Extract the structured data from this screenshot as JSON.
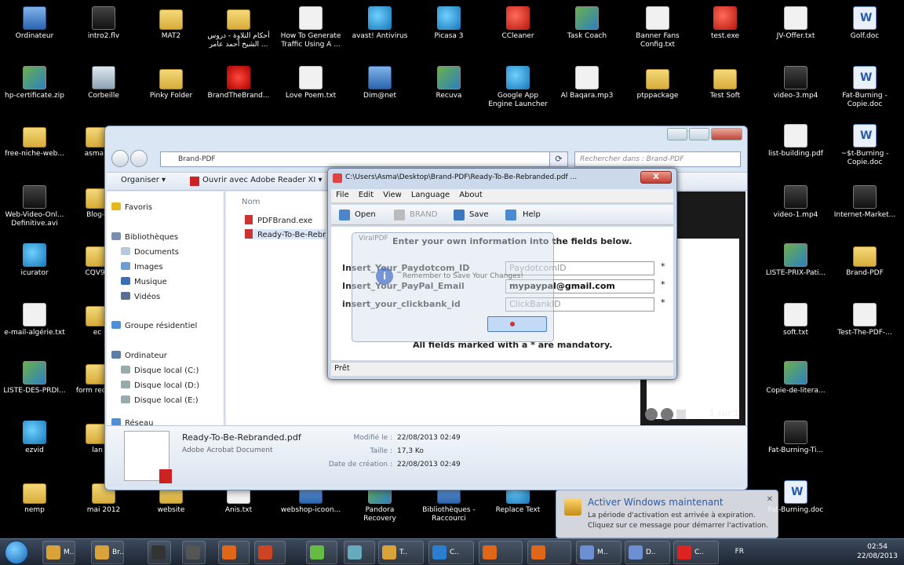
{
  "desktop": {
    "icons": [
      {
        "label": "Ordinateur",
        "icon": "computer-icon"
      },
      {
        "label": "intro2.flv",
        "icon": "video-file-icon"
      },
      {
        "label": "MAT2",
        "icon": "folder-icon"
      },
      {
        "label": "أحكام التلاوة - دروس الشيخ أحمد عامر ...",
        "icon": "folder-icon"
      },
      {
        "label": "How To Generate Traffic Using A ...",
        "icon": "text-file-icon"
      },
      {
        "label": "avast! Antivirus",
        "icon": "avast-icon"
      },
      {
        "label": "Picasa 3",
        "icon": "picasa-icon"
      },
      {
        "label": "CCleaner",
        "icon": "ccleaner-icon"
      },
      {
        "label": "Task Coach",
        "icon": "task-coach-icon"
      },
      {
        "label": "Banner Fans Config.txt",
        "icon": "text-file-icon"
      },
      {
        "label": "test.exe",
        "icon": "exe-icon"
      },
      {
        "label": "JV-Offer.txt",
        "icon": "text-file-icon"
      },
      {
        "label": "Golf.doc",
        "icon": "word-doc-icon"
      },
      {
        "label": "hp-certificate.zip",
        "icon": "zip-icon"
      },
      {
        "label": "Corbeille",
        "icon": "recycle-bin-icon"
      },
      {
        "label": "Pinky Folder",
        "icon": "folder-icon"
      },
      {
        "label": "BrandTheBrand...",
        "icon": "viralpdf-icon"
      },
      {
        "label": "Love Poem.txt",
        "icon": "text-file-icon"
      },
      {
        "label": "Dim@net",
        "icon": "app-icon"
      },
      {
        "label": "Recuva",
        "icon": "recuva-icon"
      },
      {
        "label": "Google App Engine Launcher",
        "icon": "app-engine-icon"
      },
      {
        "label": "Al Baqara.mp3",
        "icon": "audio-file-icon"
      },
      {
        "label": "ptppackage",
        "icon": "folder-icon"
      },
      {
        "label": "Test Soft",
        "icon": "folder-icon"
      },
      {
        "label": "video-3.mp4",
        "icon": "video-file-icon"
      },
      {
        "label": "Fat-Burning - Copie.doc",
        "icon": "word-doc-icon"
      },
      {
        "label": "free-niche-web...",
        "icon": "folder-icon"
      },
      {
        "label": "asma v",
        "icon": "folder-icon"
      },
      {
        "label": "Web-Video-Onl... Definitive.avi",
        "icon": "video-file-icon"
      },
      {
        "label": "Blog-T",
        "icon": "folder-icon"
      },
      {
        "label": "icurator",
        "icon": "icurator-icon"
      },
      {
        "label": "CQV9n",
        "icon": "folder-icon"
      },
      {
        "label": "e-mail-algérie.txt",
        "icon": "text-file-icon"
      },
      {
        "label": "ec",
        "icon": "folder-icon"
      },
      {
        "label": "LISTE-DES-PRDI...",
        "icon": "excel-icon"
      },
      {
        "label": "form receve",
        "icon": "folder-icon"
      },
      {
        "label": "ezvid",
        "icon": "ezvid-icon"
      },
      {
        "label": "lan",
        "icon": "folder-icon"
      },
      {
        "label": "nemp",
        "icon": "folder-icon"
      },
      {
        "label": "mai 2012",
        "icon": "folder-icon"
      },
      {
        "label": "website",
        "icon": "folder-icon"
      },
      {
        "label": "Anis.txt",
        "icon": "text-file-icon"
      },
      {
        "label": "webshop-icoon...",
        "icon": "app-icon"
      },
      {
        "label": "Pandora Recovery",
        "icon": "pandora-icon"
      },
      {
        "label": "Bibliothèques - Raccourci",
        "icon": "library-icon"
      },
      {
        "label": "Replace Text",
        "icon": "replace-text-icon"
      },
      {
        "label": "list-building.pdf",
        "icon": "pdf-file-icon"
      },
      {
        "label": "~$t-Burning - Copie.doc",
        "icon": "word-doc-icon"
      },
      {
        "label": "video-1.mp4",
        "icon": "video-file-icon"
      },
      {
        "label": "Internet-Market...",
        "icon": "book-icon"
      },
      {
        "label": "LISTE-PRIX-Pati...",
        "icon": "excel-icon"
      },
      {
        "label": "Brand-PDF",
        "icon": "folder-icon"
      },
      {
        "label": "soft.txt",
        "icon": "text-file-icon"
      },
      {
        "label": "Test-The-PDF-...",
        "icon": "text-file-icon"
      },
      {
        "label": "Copie-de-litera...",
        "icon": "excel-icon"
      },
      {
        "label": "Fat-Burning-Ti...",
        "icon": "book-icon"
      },
      {
        "label": "Fat-Burning.doc",
        "icon": "word-doc-icon"
      }
    ]
  },
  "explorer": {
    "address": "Brand-PDF",
    "search_placeholder": "Rechercher dans : Brand-PDF",
    "toolbar": {
      "organize": "Organiser ▾",
      "open_with": "Ouvrir avec Adobe Reader XI ▾"
    },
    "nav": {
      "favorites": "Favoris",
      "libraries": "Bibliothèques",
      "documents": "Documents",
      "images": "Images",
      "music": "Musique",
      "videos": "Vidéos",
      "homegroup": "Groupe résidentiel",
      "computer": "Ordinateur",
      "disk_c": "Disque local (C:)",
      "disk_d": "Disque local (D:)",
      "disk_e": "Disque local (E:)",
      "network": "Réseau"
    },
    "column_name": "Nom",
    "files": [
      {
        "name": "PDFBrand.exe"
      },
      {
        "name": "Ready-To-Be-Rebr"
      }
    ],
    "preview": {
      "page_counter": "1 sur 1"
    },
    "details": {
      "filename": "Ready-To-Be-Rebranded.pdf",
      "filetype": "Adobe Acrobat Document",
      "modified_label": "Modifié le :",
      "modified_value": "22/08/2013 02:49",
      "size_label": "Taille :",
      "size_value": "17,3 Ko",
      "created_label": "Date de création :",
      "created_value": "22/08/2013 02:49"
    }
  },
  "brand_window": {
    "title": "C:\\Users\\Asma\\Desktop\\Brand-PDF\\Ready-To-Be-Rebranded.pdf ...",
    "menu": [
      "File",
      "Edit",
      "View",
      "Language",
      "About"
    ],
    "toolbar": {
      "open": "Open",
      "brand": "BRAND",
      "save": "Save",
      "help": "Help"
    },
    "headline": "Enter your own information into the fields below.",
    "fields": [
      {
        "label": "Insert_Your_Paydotcom_ID",
        "value": "PaydotcomID",
        "filled": false
      },
      {
        "label": "Insert_Your_PayPal_Email",
        "value": "mypaypal@gmail.com",
        "filled": true
      },
      {
        "label": "insert_your_clickbank_id",
        "value": "ClickBankID",
        "filled": false
      }
    ],
    "required_mark": "*",
    "mandatory_note": "All fields marked with a * are mandatory.",
    "status": "Prêt"
  },
  "message_box": {
    "title": "ViralPDF",
    "message": "Remember to Save Your Changes!"
  },
  "activation": {
    "title": "Activer Windows maintenant",
    "line1": "La période d'activation est arrivée à expiration.",
    "line2": "Cliquez sur ce message pour démarrer l'activation."
  },
  "taskbar": {
    "buttons": [
      {
        "label": "M.."
      },
      {
        "label": "Br.."
      },
      {
        "label": ""
      },
      {
        "label": ""
      },
      {
        "label": ""
      },
      {
        "label": ""
      },
      {
        "label": ""
      },
      {
        "label": ""
      },
      {
        "label": "T.."
      },
      {
        "label": "C.."
      },
      {
        "label": "S.."
      },
      {
        "label": ""
      },
      {
        "label": ""
      },
      {
        "label": "M.."
      },
      {
        "label": "D.."
      },
      {
        "label": "C.."
      }
    ],
    "language": "FR",
    "time": "02:54",
    "date": "22/08/2013"
  }
}
